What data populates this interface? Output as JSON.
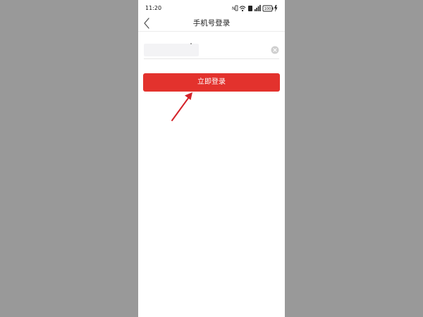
{
  "status_bar": {
    "time": "11:20",
    "battery_level": "100",
    "icons": [
      "nfc-icon",
      "wifi-icon",
      "sim-icon",
      "signal-icon",
      "battery-icon",
      "charging-icon"
    ]
  },
  "nav": {
    "back_icon": "chevron-left-icon",
    "title": "手机号登录"
  },
  "phone_input": {
    "value": "",
    "state": "value-obscured",
    "clear_icon": "clear-circle-icon"
  },
  "login_button": {
    "label": "立即登录"
  },
  "annotation": {
    "arrow_icon": "red-arrow-icon"
  },
  "colors": {
    "accent": "#e3322d",
    "background": "#999999",
    "screen": "#ffffff",
    "annotation": "#d4232a"
  }
}
